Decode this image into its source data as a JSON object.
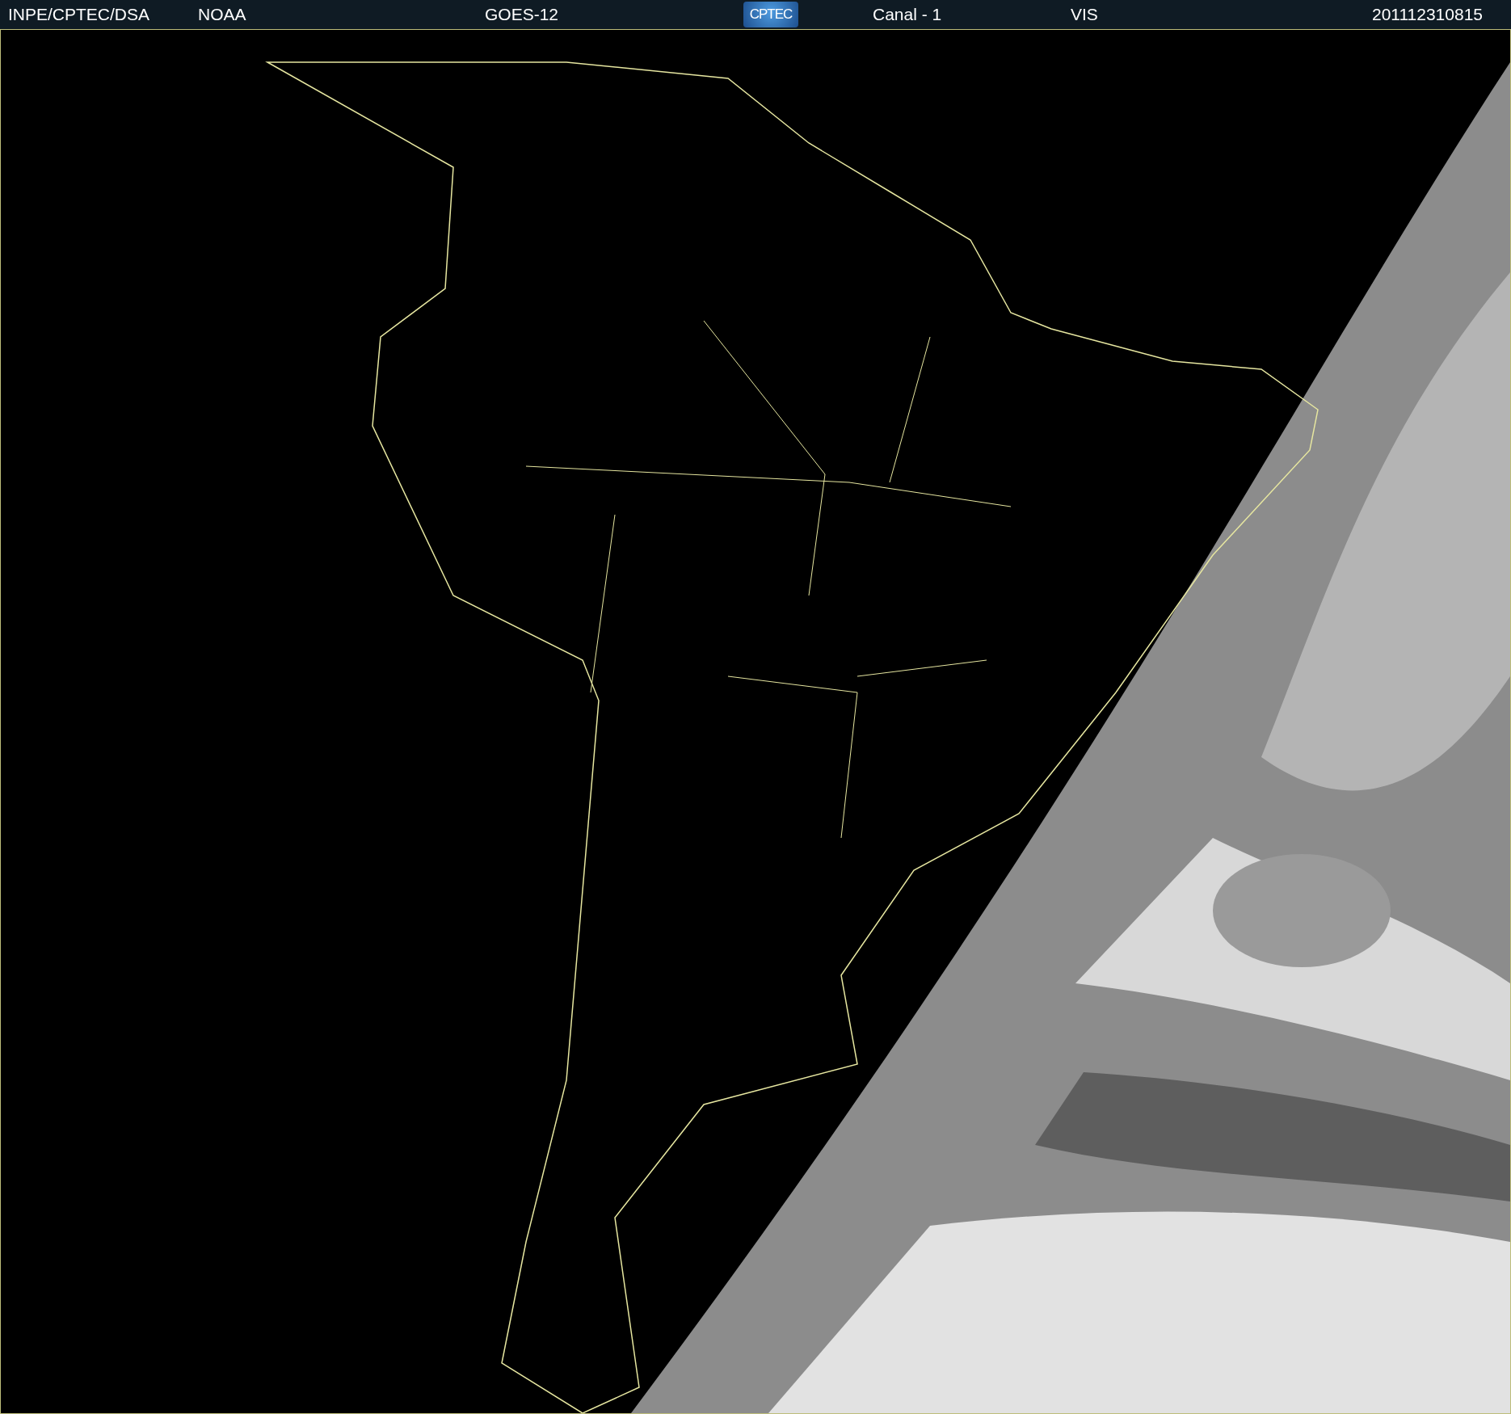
{
  "header": {
    "agency": "INPE/CPTEC/DSA",
    "source": "NOAA",
    "satellite": "GOES-12",
    "logo": "CPTEC",
    "channel": "Canal - 1",
    "band": "VIS",
    "timestamp": "201112310815"
  }
}
